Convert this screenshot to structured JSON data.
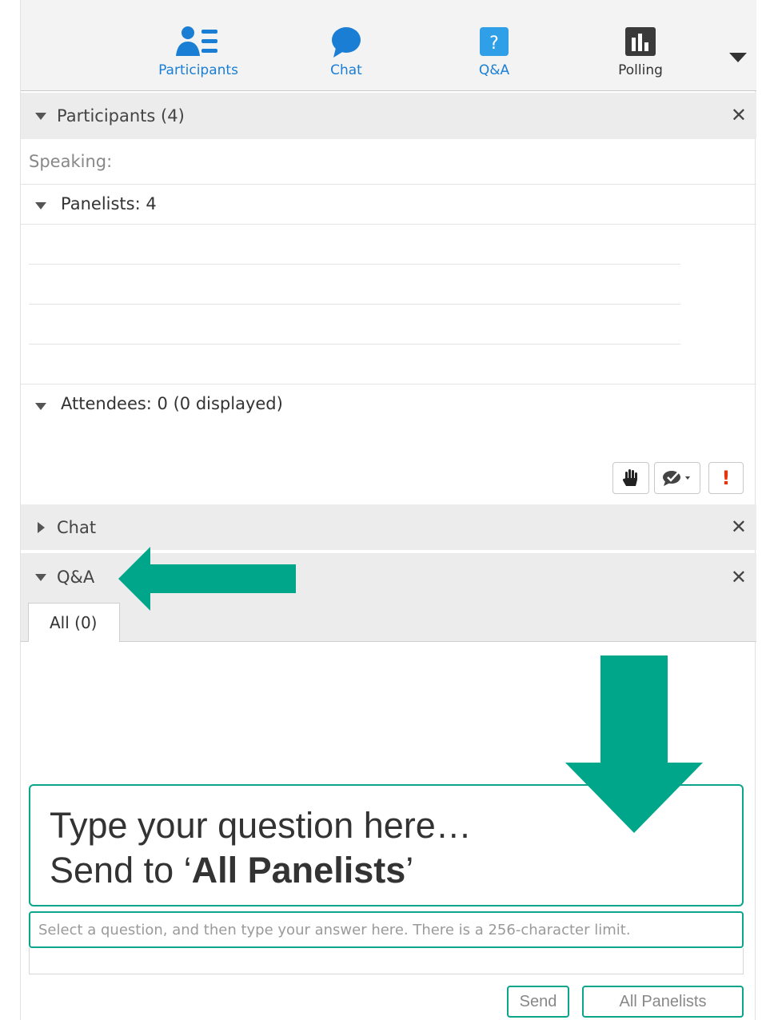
{
  "toolbar": {
    "tabs": [
      {
        "label": "Participants",
        "icon": "participants-icon"
      },
      {
        "label": "Chat",
        "icon": "chat-bubble-icon"
      },
      {
        "label": "Q&A",
        "icon": "question-icon"
      },
      {
        "label": "Polling",
        "icon": "bar-chart-icon"
      }
    ],
    "qa_icon_glyph": "?",
    "menu_icon": "chevron-down-icon"
  },
  "participants": {
    "title": "Participants (4)",
    "speaking_label": "Speaking:",
    "panelists_label": "Panelists: 4",
    "attendees_label": "Attendees: 0 (0 displayed)",
    "close_glyph": "✕",
    "actions": [
      {
        "icon": "raise-hand-icon"
      },
      {
        "icon": "feedback-icon"
      },
      {
        "icon": "alert-icon",
        "glyph": "!"
      }
    ]
  },
  "chat": {
    "title": "Chat",
    "close_glyph": "✕"
  },
  "qa": {
    "title": "Q&A",
    "close_glyph": "✕",
    "tab_label": "All (0)",
    "callout_line1": "Type your question here…",
    "callout_line2_prefix": "Send to ‘",
    "callout_line2_bold": "All Panelists",
    "callout_line2_suffix": "’",
    "answer_placeholder": "Select a question, and then type your answer here. There is a 256-character limit.",
    "send_label": "Send",
    "recipient_label": "All Panelists"
  },
  "colors": {
    "accent_teal": "#00a68a",
    "link_blue": "#1a7ed4",
    "alert_red": "#e8340c"
  }
}
